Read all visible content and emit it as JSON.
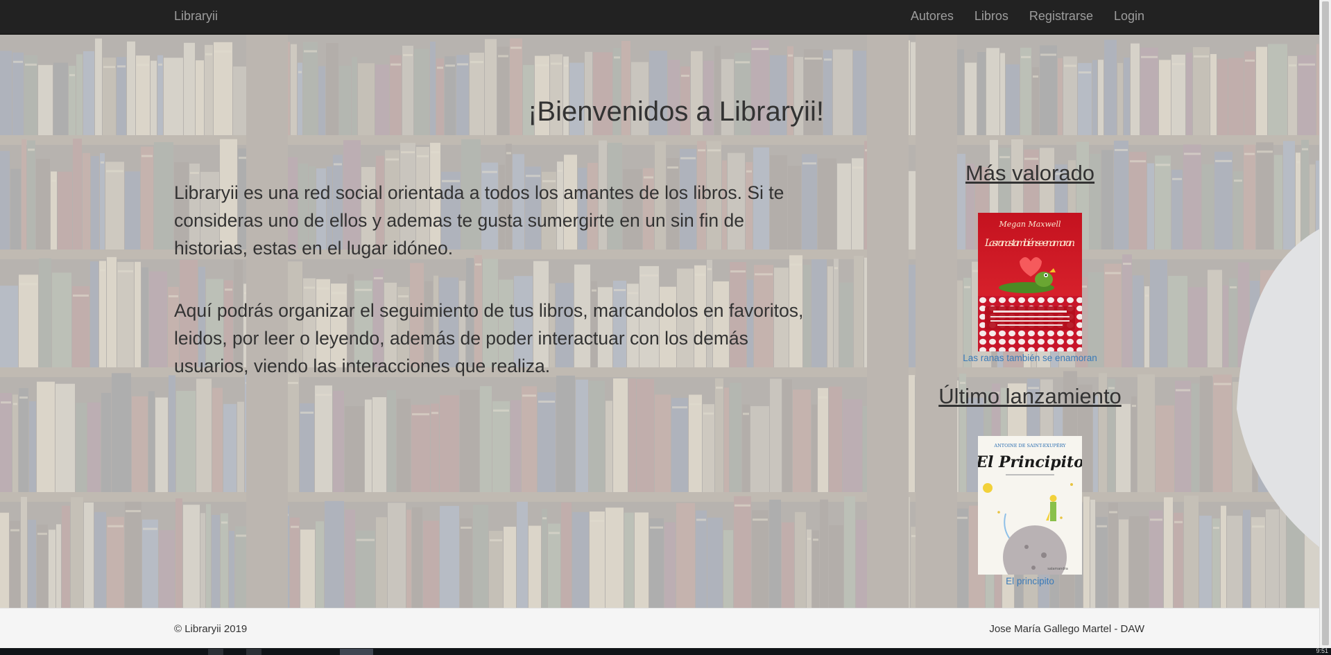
{
  "navbar": {
    "brand": "Libraryii",
    "links": [
      "Autores",
      "Libros",
      "Registrarse",
      "Login"
    ]
  },
  "main": {
    "title": "¡Bienvenidos a Libraryii!",
    "paragraphs": [
      "Libraryii es una red social orientada a todos los amantes de los libros. Si te consideras uno de ellos y ademas te gusta sumergirte en un sin fin de historias, estas en el lugar idóneo.",
      "Aquí podrás organizar el seguimiento de tus libros, marcandolos en favoritos, leidos, por leer o leyendo, además de poder interactuar con los demás usuarios, viendo las interacciones que realiza."
    ]
  },
  "sidebar": {
    "top_rated": {
      "heading": "Más valorado",
      "book_title": "Las ranas también se enamoran",
      "cover_author": "Megan Maxwell",
      "cover_title": "Las ranas también se enamoran"
    },
    "latest": {
      "heading": "Último lanzamiento",
      "book_title": "El principito",
      "cover_author": "ANTOINE DE SAINT-EXUPÉRY",
      "cover_title": "El Principito"
    }
  },
  "footer": {
    "copyright": "© Libraryii 2019",
    "author": "Jose María Gallego Martel - DAW"
  },
  "taskbar": {
    "clock": "9:51"
  },
  "colors": {
    "navbar_bg": "#222222",
    "nav_text": "#9d9d9d",
    "link": "#3a7ab8",
    "footer_bg": "#f5f5f5"
  }
}
